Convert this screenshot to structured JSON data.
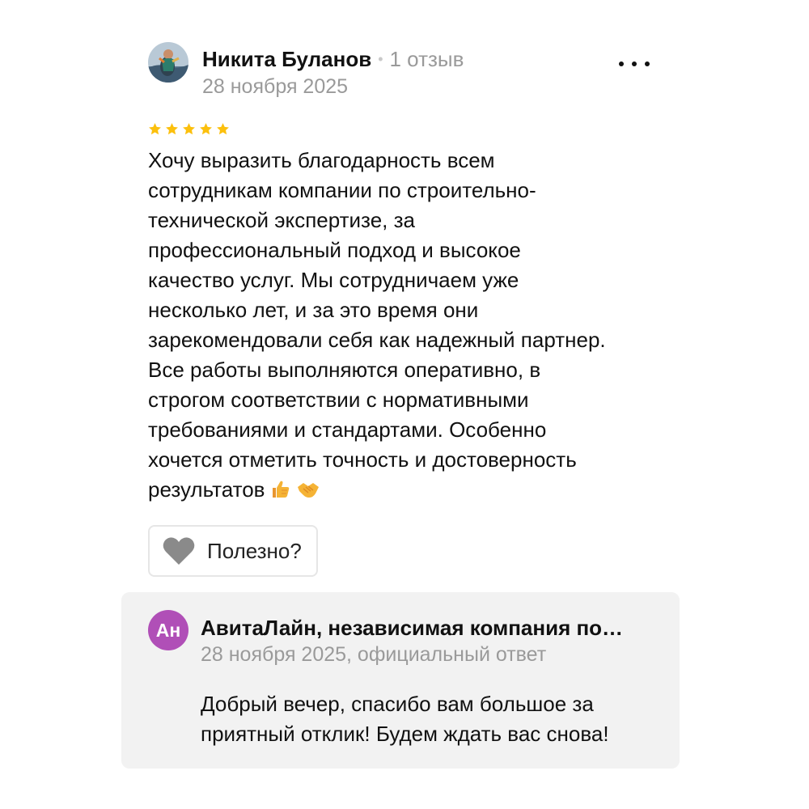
{
  "review": {
    "author_name": "Никита Буланов",
    "separator": "•",
    "review_count": "1 отзыв",
    "date": "28 ноября 2025",
    "rating": 5,
    "text": "Хочу выразить благодарность всем\nсотрудникам компании по строительно-\nтехнической экспертизе, за\nпрофессиональный подход и высокое\nкачество услуг. Мы сотрудничаем уже\nнесколько лет, и за это время они\nзарекомендовали себя как надежный партнер.\nВсе работы выполняются оперативно, в\nстрогом соответствии с нормативными\nтребованиями и стандартами. Особенно\nхочется отметить точность и достоверность\nрезультатов",
    "helpful_label": "Полезно?"
  },
  "reply": {
    "avatar_initials": "Ан",
    "company_name": "АвитаЛайн, независимая компания по…",
    "meta": "28 ноября 2025, официальный ответ",
    "text": "Добрый вечер, спасибо вам большое за\nприятный отклик! Будем ждать вас снова!"
  },
  "colors": {
    "star": "#fcc00d",
    "muted_text": "#9a9a9a",
    "reply_background": "#f2f2f2",
    "reply_avatar": "#b04fb7",
    "heart": "#8a8a8a"
  },
  "icons": {
    "more": "more-horizontal-icon",
    "star": "star-icon",
    "heart": "heart-icon",
    "emoji_1": "thumbs-up-emoji",
    "emoji_2": "handshake-emoji"
  }
}
